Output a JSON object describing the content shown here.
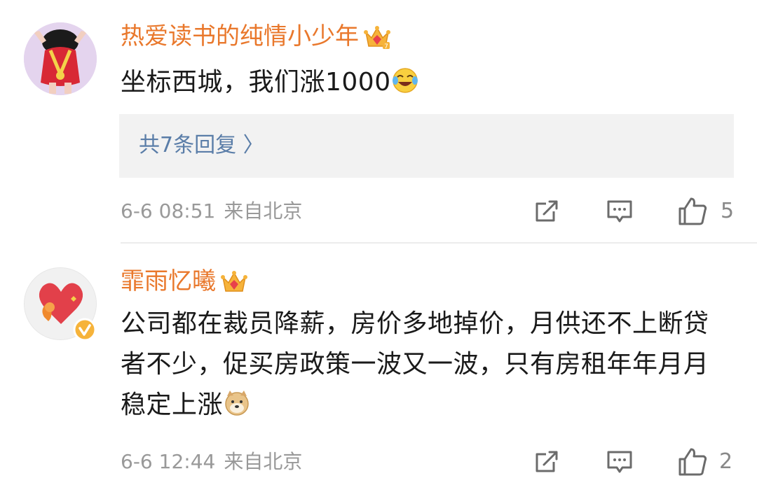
{
  "comments": [
    {
      "username": "热爱读书的纯情小少年",
      "badge_icon": "crown-icon",
      "text": "坐标西城，我们涨1000",
      "text_emoji": "laughing-crying-emoji",
      "replies_link": "共7条回复 〉",
      "timestamp": "6-6 08:51",
      "source": "来自北京",
      "likes": "5"
    },
    {
      "username": "霏雨忆曦",
      "badge_icon": "crown-icon",
      "text": "公司都在裁员降薪，房价多地掉价，月供还不上断贷者不少，促买房政策一波又一波，只有房租年年月月稳定上涨",
      "text_emoji": "doge-emoji",
      "verified_icon": "verified-badge-icon",
      "timestamp": "6-6 12:44",
      "source": "来自北京",
      "likes": "2"
    }
  ],
  "colors": {
    "username": "#e9782c",
    "link": "#5a7da8",
    "meta": "#999999",
    "reply_bg": "#f2f2f2"
  }
}
